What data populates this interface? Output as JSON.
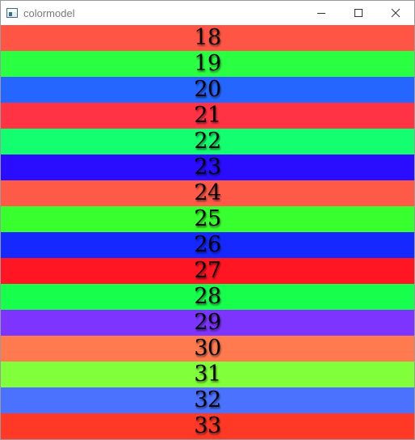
{
  "window": {
    "title": "colormodel",
    "icon": "app-window-icon",
    "controls": {
      "minimize_icon": "minimize-icon",
      "maximize_icon": "maximize-icon",
      "close_icon": "close-icon"
    }
  },
  "bands": [
    {
      "label": "18",
      "color": "#ff5544"
    },
    {
      "label": "19",
      "color": "#2aff42"
    },
    {
      "label": "20",
      "color": "#2466ff"
    },
    {
      "label": "21",
      "color": "#ff3344"
    },
    {
      "label": "22",
      "color": "#13ff70"
    },
    {
      "label": "23",
      "color": "#2a0cff"
    },
    {
      "label": "24",
      "color": "#ff5a48"
    },
    {
      "label": "25",
      "color": "#38ff2e"
    },
    {
      "label": "26",
      "color": "#1428ff"
    },
    {
      "label": "27",
      "color": "#ff1622"
    },
    {
      "label": "28",
      "color": "#16ff4c"
    },
    {
      "label": "29",
      "color": "#7d34ff"
    },
    {
      "label": "30",
      "color": "#ff7a4e"
    },
    {
      "label": "31",
      "color": "#80ff3a"
    },
    {
      "label": "32",
      "color": "#4a72ff"
    },
    {
      "label": "33",
      "color": "#ff3926"
    }
  ]
}
